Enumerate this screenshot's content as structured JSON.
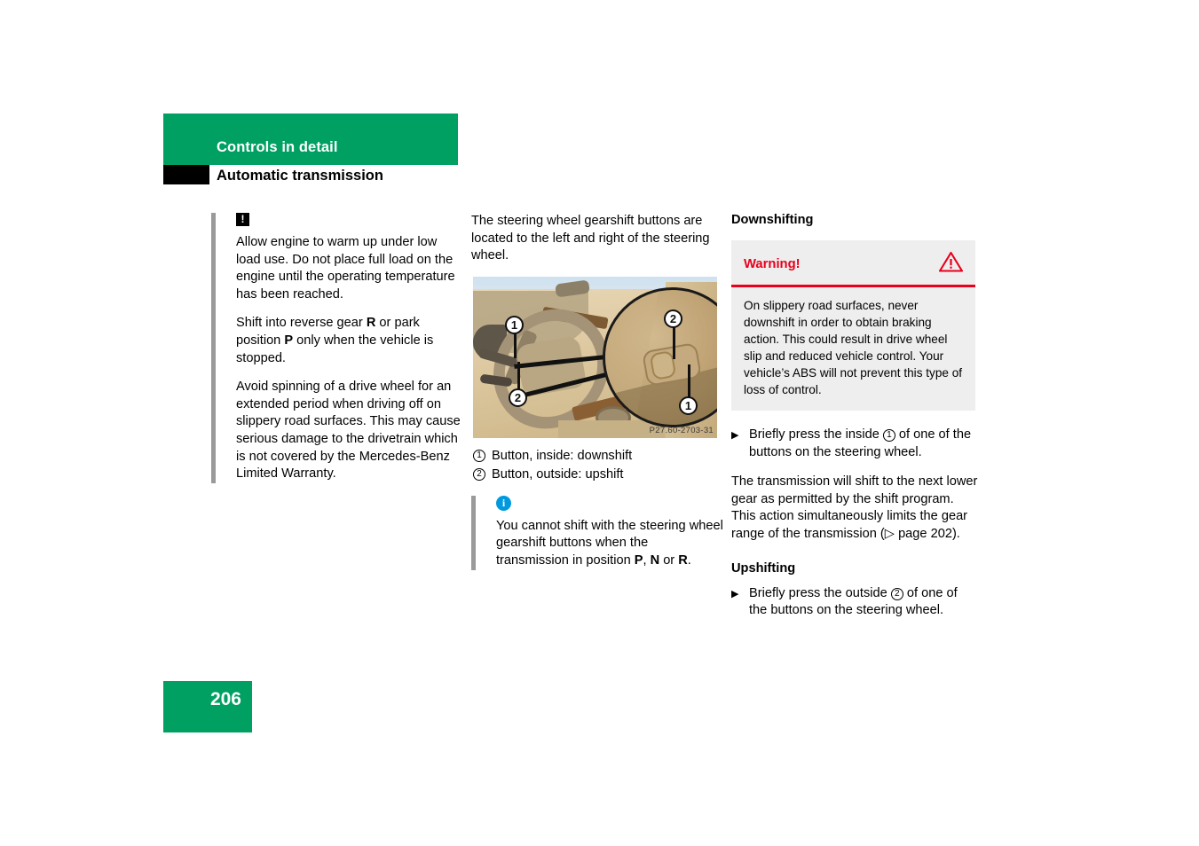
{
  "header": {
    "chapter_title": "Controls in detail",
    "section_title": "Automatic transmission",
    "green": "#00a063"
  },
  "left_column": {
    "attention_note": {
      "icon": "attention-exclamation-icon",
      "icon_glyph": "!",
      "paragraphs": [
        "Allow engine to warm up under low load use. Do not place full load on the engine until the operating temperature has been reached.",
        "Avoid spinning of a drive wheel for an extended period when driving off on slippery road surfaces. This may cause serious damage to the drivetrain which is not covered by the Mercedes-Benz Limited Warranty."
      ],
      "shift_paragraph": {
        "part1": "Shift into reverse gear ",
        "bold1": "R",
        "part2": " or park position ",
        "bold2": "P",
        "part3": " only when the vehicle is stopped."
      }
    }
  },
  "middle_column": {
    "intro": "The steering wheel gearshift buttons are located to the left and right of the steering wheel.",
    "figure": {
      "code": "P27.60-2703-31",
      "callouts": [
        "1",
        "2",
        "2",
        "1"
      ]
    },
    "legend": [
      {
        "number": "1",
        "text": "Button, inside: downshift"
      },
      {
        "number": "2",
        "text": "Button, outside: upshift"
      }
    ],
    "info_note": {
      "icon": "info-circle-icon",
      "icon_glyph": "i",
      "part1": "You cannot shift with the steering wheel gearshift buttons when the transmission in position ",
      "bold1": "P",
      "sep1": ", ",
      "bold2": "N",
      "sep2": " or ",
      "bold3": "R",
      "part_end": "."
    }
  },
  "right_column": {
    "downshifting_heading": "Downshifting",
    "warning": {
      "title": "Warning!",
      "icon": "warning-triangle-icon",
      "accent_color": "#e8001c",
      "body": "On slippery road surfaces, never downshift in order to obtain braking action. This could result in drive wheel slip and reduced vehicle control. Your vehicle’s ABS will not prevent this type of loss of control."
    },
    "downshift_step": {
      "arrow": "▶",
      "part1": "Briefly press the inside ",
      "number": "1",
      "part2": " of one of the buttons on the steering wheel."
    },
    "downshift_paragraph": {
      "part1": "The transmission will shift to the next lower gear as permitted by the shift program. This action simultaneously limits the gear range of the transmission (",
      "ref_arrow": "▷",
      "part2": " page 202)."
    },
    "upshifting_heading": "Upshifting",
    "upshift_step": {
      "arrow": "▶",
      "part1": "Briefly press the outside ",
      "number": "2",
      "part2": " of one of the buttons on the steering wheel."
    }
  },
  "footer": {
    "page_number": "206"
  }
}
